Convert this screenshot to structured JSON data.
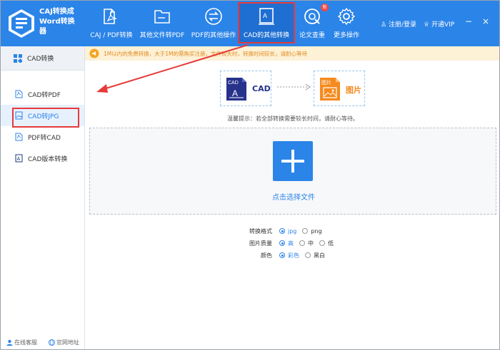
{
  "app": {
    "title_line1": "CAJ转换成",
    "title_line2": "Word转换",
    "title_line3": "器"
  },
  "nav": [
    {
      "label": "CAJ / PDF转换",
      "icon": "pdf-convert-icon"
    },
    {
      "label": "其他文件转PDF",
      "icon": "folder-icon"
    },
    {
      "label": "PDF的其他操作",
      "icon": "swap-arrows-icon"
    },
    {
      "label": "CAD的其他转换",
      "icon": "cad-convert-icon",
      "active": true
    },
    {
      "label": "论文查重",
      "icon": "paper-check-icon",
      "badge": "新"
    },
    {
      "label": "更多操作",
      "icon": "gear-icon"
    }
  ],
  "header_right": {
    "login": "注册/登录",
    "vip": "开通VIP"
  },
  "sidebar": {
    "header": "CAD转换",
    "items": [
      {
        "label": "CAD转PDF"
      },
      {
        "label": "CAD转JPG",
        "active": true
      },
      {
        "label": "PDF转CAD"
      },
      {
        "label": "CAD版本转换"
      }
    ],
    "footer": {
      "service": "在线客服",
      "website": "官网地址"
    }
  },
  "notice": "1M以内的免费转换，大于1M的需购买注册，文件较大时，转换时间较长，请耐心等待",
  "conversion": {
    "from_label": "CAD",
    "from_icon_text": "CAD",
    "to_label": "图片",
    "to_icon_text": "图片"
  },
  "tip": "温馨提示：若全部转换需要较长时间，请耐心等待。",
  "drop_zone": {
    "label": "点击选择文件"
  },
  "options": {
    "format": {
      "label": "转换格式",
      "choices": [
        "jpg",
        "png"
      ],
      "selected": "jpg"
    },
    "quality": {
      "label": "图片质量",
      "choices": [
        "高",
        "中",
        "低"
      ],
      "selected": "高"
    },
    "color": {
      "label": "颜色",
      "choices": [
        "彩色",
        "黑白"
      ],
      "selected": "彩色"
    }
  },
  "colors": {
    "accent": "#2b84e8",
    "highlight": "#e63a3a",
    "notice_bg": "#fdf1d6",
    "notice_text": "#e08a1e"
  }
}
